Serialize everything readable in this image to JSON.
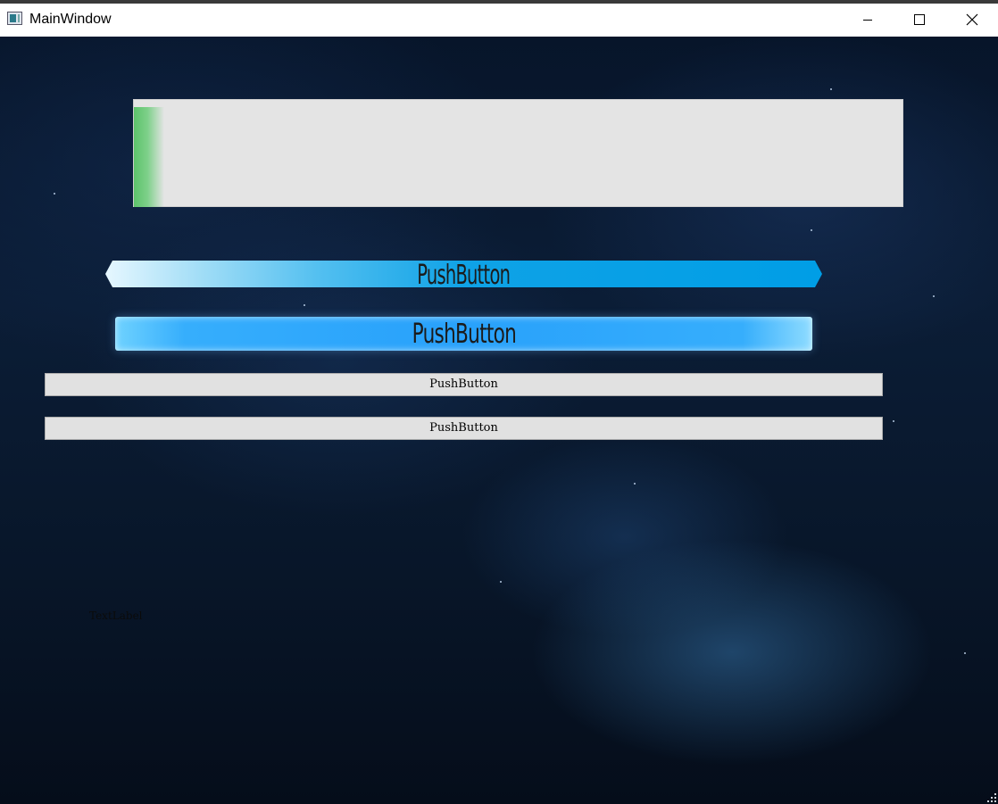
{
  "window": {
    "title": "MainWindow",
    "controls": {
      "minimize_icon": "minimize-icon",
      "maximize_icon": "maximize-icon",
      "close_icon": "close-icon"
    }
  },
  "progress_bar": {
    "value_fraction": 0.04,
    "chunk_color": "#5cc36a",
    "track_color": "#e4e4e4"
  },
  "buttons": {
    "styled_cyan": {
      "label": "PushButton",
      "color": "#009ee6"
    },
    "styled_blue": {
      "label": "PushButton",
      "color": "#28a1fb"
    },
    "plain_1": {
      "label": "PushButton"
    },
    "plain_2": {
      "label": "PushButton"
    }
  },
  "text_label": "TextLabel"
}
